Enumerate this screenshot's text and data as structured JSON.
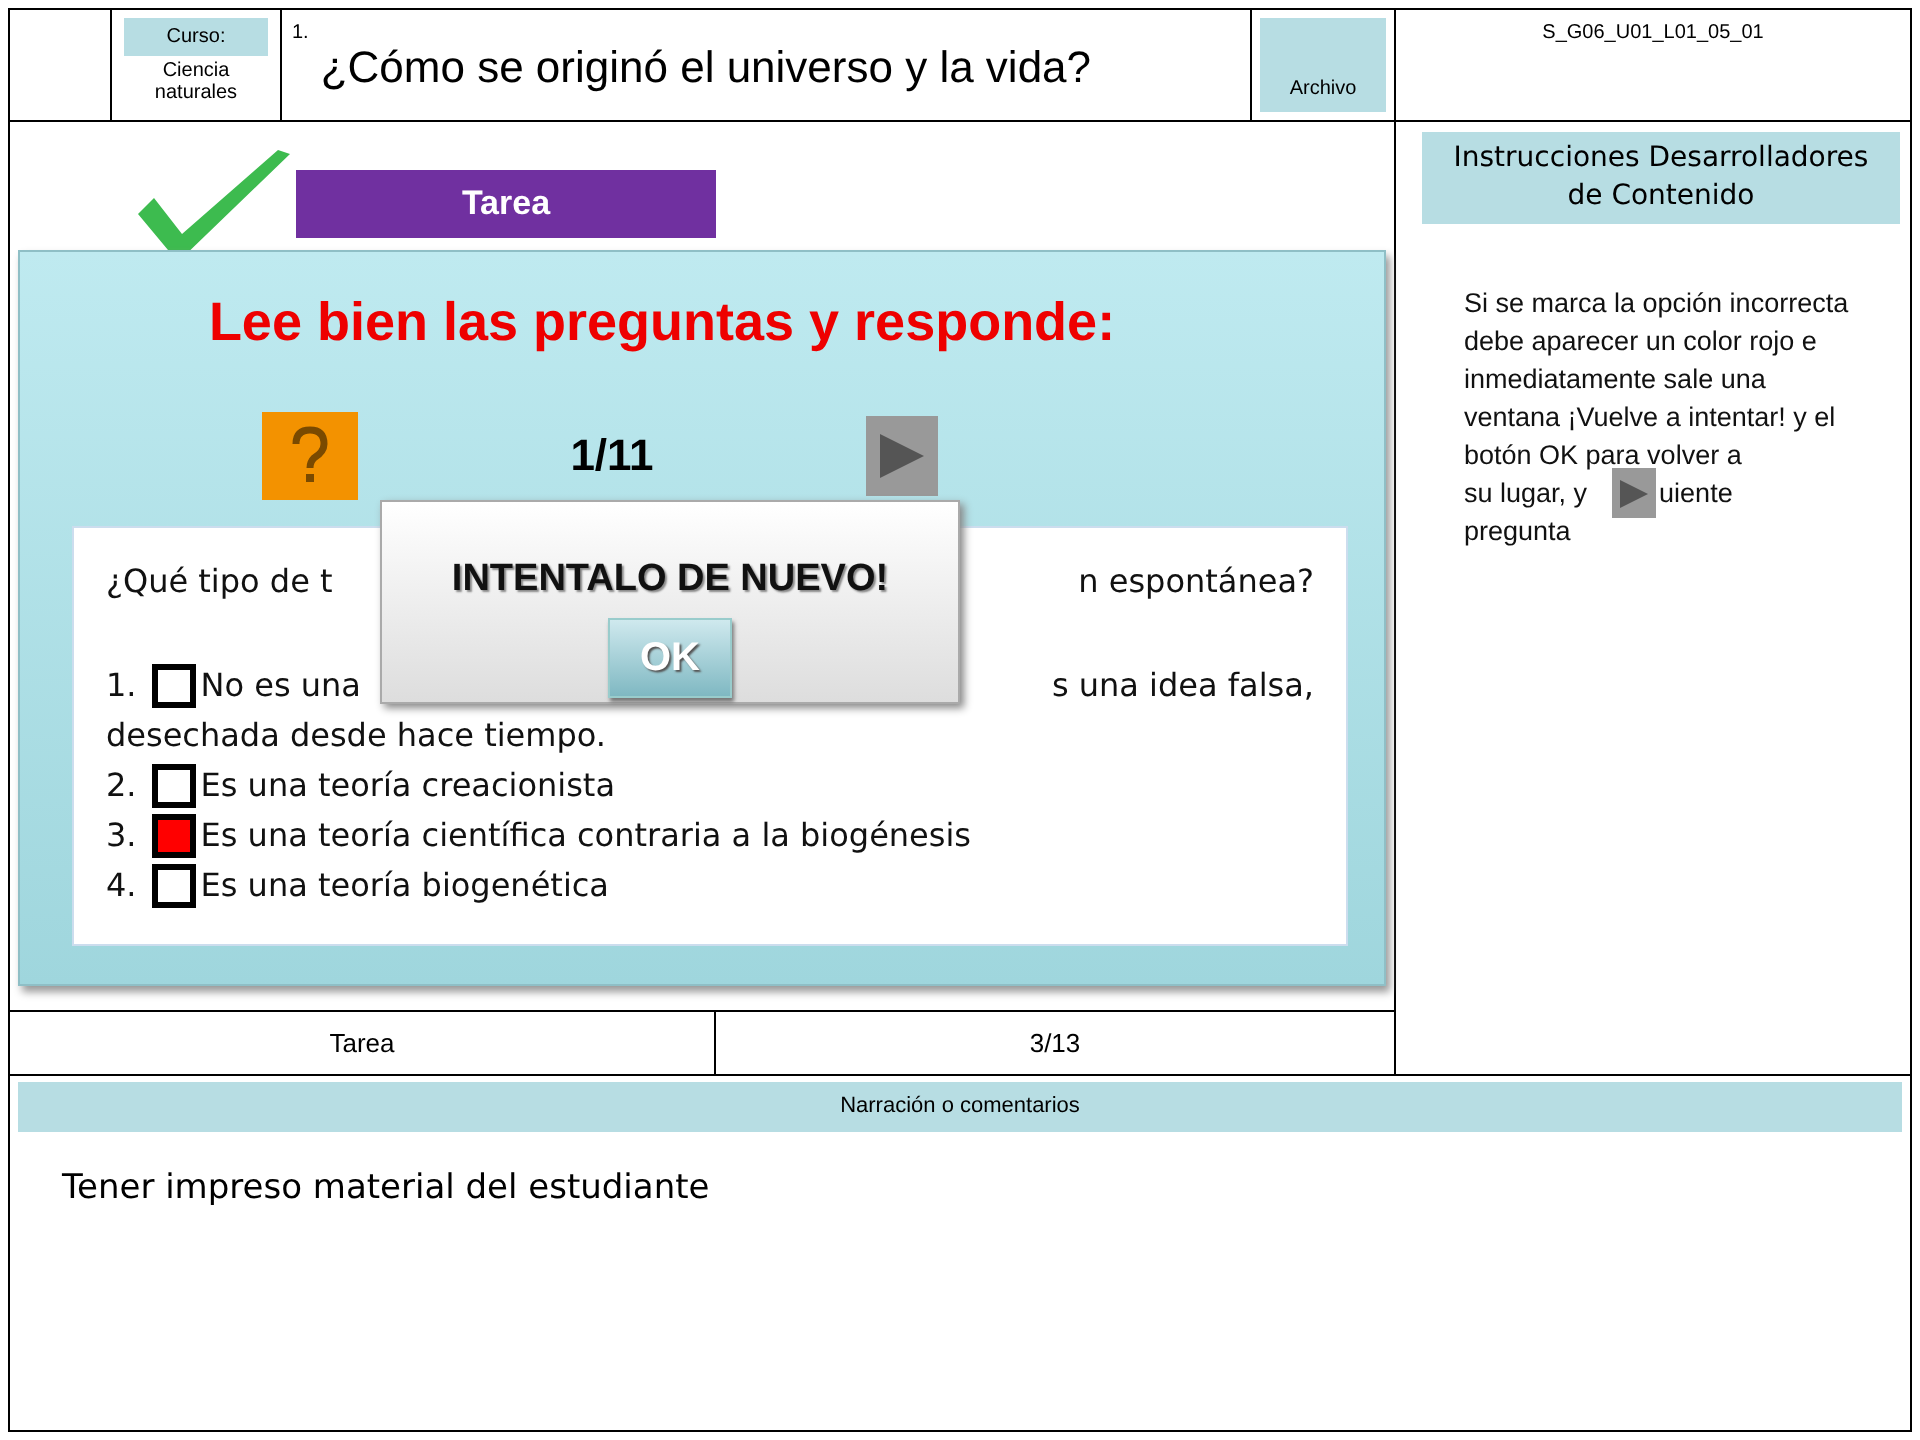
{
  "header": {
    "course_label": "Curso:",
    "course": "Ciencia naturales",
    "number": "1.",
    "title": "¿Cómo se originó el universo y la vida?",
    "file_label": "Archivo",
    "code": "S_G06_U01_L01_05_01"
  },
  "activity": {
    "banner": "Tarea",
    "heading": "Lee bien las preguntas y responde:",
    "counter": "1/11",
    "question_parts": [
      "¿Qué tipo de t",
      "n espontánea?"
    ],
    "options": [
      {
        "number": "1.",
        "parts": [
          "No es una",
          "s una idea falsa,"
        ],
        "continuation": "desechada desde hace tiempo.",
        "checked": false
      },
      {
        "number": "2.",
        "parts": [
          "Es una teoría creacionista"
        ],
        "checked": false
      },
      {
        "number": "3.",
        "parts": [
          "Es una teoría científica contraria a la biogénesis"
        ],
        "checked": true
      },
      {
        "number": "4.",
        "parts": [
          "Es una teoría biogenética"
        ],
        "checked": false
      }
    ],
    "dialog": {
      "message": "INTENTALO DE NUEVO!",
      "button": "OK"
    }
  },
  "footer_row": {
    "type": "Tarea",
    "page": "3/13"
  },
  "sidebar": {
    "heading": "Instrucciones Desarrolladores de Contenido",
    "note": "Si se marca la opción incorrecta debe aparecer un color rojo e inmediatamente sale una ventana ¡Vuelve a intentar! y el botón OK para volver a",
    "note_before_icon": "su lugar, y",
    "note_after_icon": "uiente",
    "note_end": "pregunta"
  },
  "narration": {
    "heading": "Narración o comentarios",
    "text": "Tener impreso material del estudiante"
  }
}
